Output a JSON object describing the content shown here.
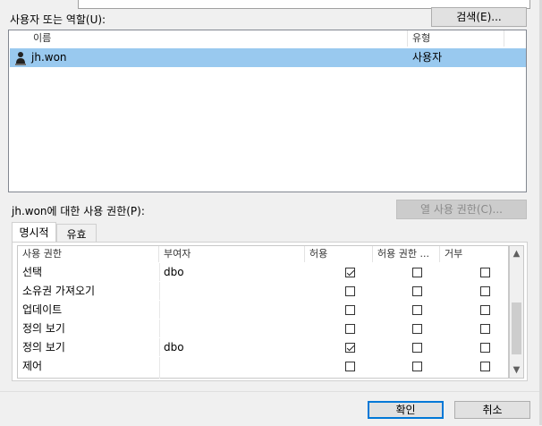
{
  "users_section": {
    "label": "사용자 또는 역할(U):",
    "search_button": "검색(E)...",
    "columns": [
      "이름",
      "유형"
    ],
    "rows": [
      {
        "name": "jh.won",
        "type": "사용자",
        "selected": true,
        "icon": "user-icon"
      }
    ]
  },
  "permissions_section": {
    "label": "jh.won에 대한 사용 권한(P):",
    "column_permissions_button": "열 사용 권한(C)...",
    "tabs": [
      "명시적",
      "유효"
    ],
    "active_tab": "명시적",
    "columns": [
      "사용 권한",
      "부여자",
      "허용",
      "허용 권한 ...",
      "거부"
    ],
    "rows": [
      {
        "permission": "선택",
        "grantor": "dbo",
        "grant": true,
        "with_grant": false,
        "deny": false
      },
      {
        "permission": "소유권 가져오기",
        "grantor": "",
        "grant": false,
        "with_grant": false,
        "deny": false
      },
      {
        "permission": "업데이트",
        "grantor": "",
        "grant": false,
        "with_grant": false,
        "deny": false
      },
      {
        "permission": "정의 보기",
        "grantor": "",
        "grant": false,
        "with_grant": false,
        "deny": false
      },
      {
        "permission": "정의 보기",
        "grantor": "dbo",
        "grant": true,
        "with_grant": false,
        "deny": false
      },
      {
        "permission": "제어",
        "grantor": "",
        "grant": false,
        "with_grant": false,
        "deny": false
      }
    ]
  },
  "footer": {
    "ok_button": "확인",
    "cancel_button": "취소"
  },
  "colors": {
    "selection": "#99c9ef",
    "default_button_border": "#0078d7",
    "window_bg": "#f0f0f0"
  }
}
